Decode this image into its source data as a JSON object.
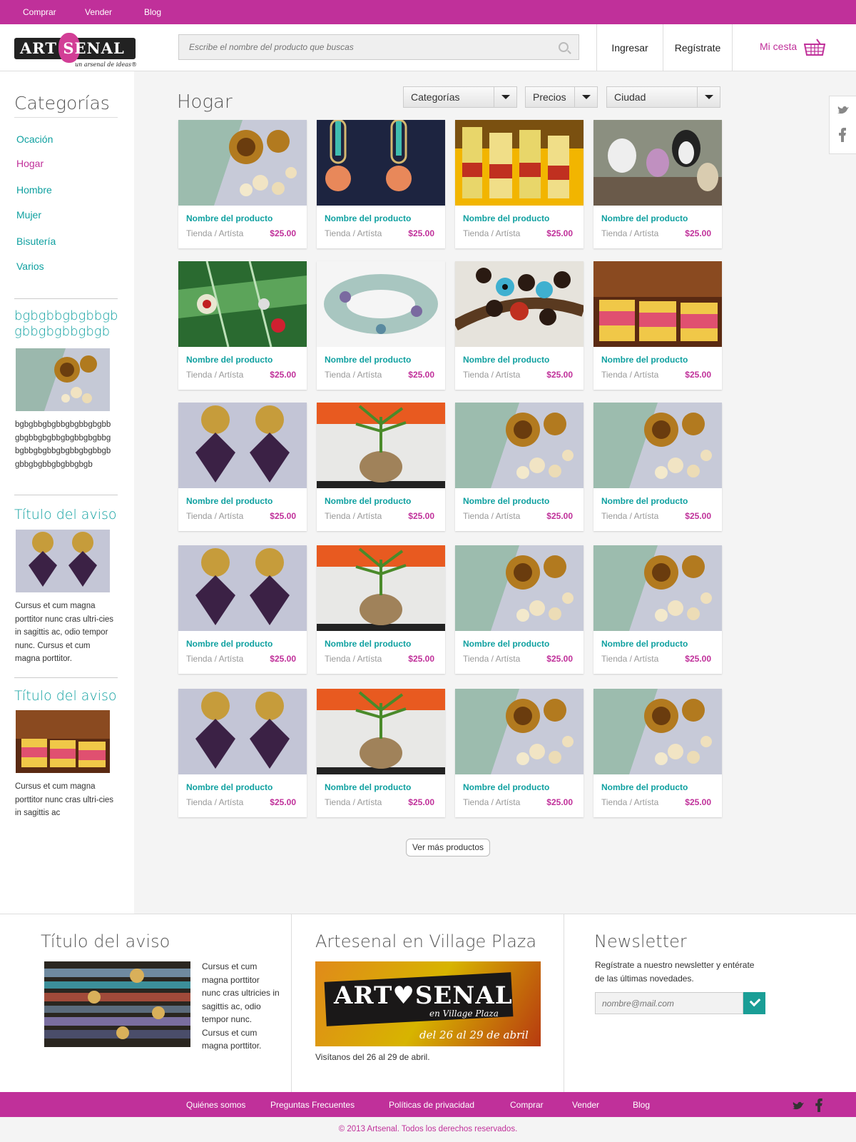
{
  "topnav": {
    "items": [
      "Comprar",
      "Vender",
      "Blog"
    ]
  },
  "header": {
    "logo": {
      "text": "ART SENAL",
      "tagline": "un arsenal de ideas®"
    },
    "search": {
      "placeholder": "Escribe el nombre del producto que buscas",
      "icon": "search-icon"
    },
    "login_label": "Ingresar",
    "register_label": "Regístrate",
    "cart_label": "Mi cesta",
    "cart_icon": "basket-icon"
  },
  "sidebar": {
    "title": "Categorías",
    "categories": [
      "Ocación",
      "Hogar",
      "Hombre",
      "Mujer",
      "Bisutería",
      "Varios"
    ],
    "active_category": "Hogar",
    "promo1": {
      "title": "bgbgbbgbgbbgbgbbgbgbbgbgb",
      "text": "bgbgbbgbgbbgbgbbgbgbbgbgbbgbgbbgbgbbgbgbbgbgbbgbgbbgbgbbgbgbbgbgbbgbgbbgbgbbgbgb"
    },
    "promo2": {
      "title": "Título del aviso",
      "text": "Cursus et cum magna porttitor nunc cras ultri-cies in sagittis ac, odio tempor nunc. Cursus et cum magna porttitor."
    },
    "promo3": {
      "title": "Título del aviso",
      "text": "Cursus et cum magna porttitor nunc cras ultri-cies in sagittis ac"
    }
  },
  "main": {
    "title": "Hogar",
    "filters": [
      "Categorías",
      "Precios",
      "Ciudad"
    ],
    "social": [
      "twitter-icon",
      "facebook-icon"
    ],
    "products": [
      {
        "name": "Nombre del producto",
        "store": "Tienda / Artísta",
        "price": "$25.00",
        "image": "earrings-knot"
      },
      {
        "name": "Nombre del producto",
        "store": "Tienda / Artísta",
        "price": "$25.00",
        "image": "necklace-turquoise"
      },
      {
        "name": "Nombre del producto",
        "store": "Tienda / Artísta",
        "price": "$25.00",
        "image": "bottles"
      },
      {
        "name": "Nombre del producto",
        "store": "Tienda / Artísta",
        "price": "$25.00",
        "image": "penguins"
      },
      {
        "name": "Nombre del producto",
        "store": "Tienda / Artísta",
        "price": "$25.00",
        "image": "brooches"
      },
      {
        "name": "Nombre del producto",
        "store": "Tienda / Artísta",
        "price": "$25.00",
        "image": "bracelet"
      },
      {
        "name": "Nombre del producto",
        "store": "Tienda / Artísta",
        "price": "$25.00",
        "image": "beads"
      },
      {
        "name": "Nombre del producto",
        "store": "Tienda / Artísta",
        "price": "$25.00",
        "image": "jars"
      },
      {
        "name": "Nombre del producto",
        "store": "Tienda / Artísta",
        "price": "$25.00",
        "image": "earrings-flower"
      },
      {
        "name": "Nombre del producto",
        "store": "Tienda / Artísta",
        "price": "$25.00",
        "image": "plant"
      },
      {
        "name": "Nombre del producto",
        "store": "Tienda / Artísta",
        "price": "$25.00",
        "image": "earrings-knot"
      },
      {
        "name": "Nombre del producto",
        "store": "Tienda / Artísta",
        "price": "$25.00",
        "image": "earrings-knot"
      },
      {
        "name": "Nombre del producto",
        "store": "Tienda / Artísta",
        "price": "$25.00",
        "image": "earrings-flower"
      },
      {
        "name": "Nombre del producto",
        "store": "Tienda / Artísta",
        "price": "$25.00",
        "image": "plant"
      },
      {
        "name": "Nombre del producto",
        "store": "Tienda / Artísta",
        "price": "$25.00",
        "image": "earrings-knot"
      },
      {
        "name": "Nombre del producto",
        "store": "Tienda / Artísta",
        "price": "$25.00",
        "image": "earrings-knot"
      },
      {
        "name": "Nombre del producto",
        "store": "Tienda / Artísta",
        "price": "$25.00",
        "image": "earrings-flower"
      },
      {
        "name": "Nombre del producto",
        "store": "Tienda / Artísta",
        "price": "$25.00",
        "image": "plant"
      },
      {
        "name": "Nombre del producto",
        "store": "Tienda / Artísta",
        "price": "$25.00",
        "image": "earrings-knot"
      },
      {
        "name": "Nombre del producto",
        "store": "Tienda / Artísta",
        "price": "$25.00",
        "image": "earrings-knot"
      }
    ],
    "more_label": "Ver más productos"
  },
  "footer_panels": {
    "ad": {
      "title": "Título del aviso",
      "text": "Cursus et cum magna porttitor nunc cras ultricies in sagittis ac, odio tempor nunc. Cursus et cum magna porttitor."
    },
    "event": {
      "title": "Artesenal en Village Plaza",
      "banner_main": "ART♥SENAL",
      "banner_sub": "en Village Plaza",
      "banner_dates": "del 26 al 29 de abril",
      "caption": "Visítanos del 26 al 29 de abril."
    },
    "newsletter": {
      "title": "Newsletter",
      "text": "Regístrate a nuestro newsletter y entérate de las últimas novedades.",
      "placeholder": "nombre@mail.com",
      "submit_icon": "check-icon"
    }
  },
  "bottomnav": {
    "items": [
      "Quiénes somos",
      "Preguntas Frecuentes",
      "Políticas de privacidad",
      "Comprar",
      "Vender",
      "Blog"
    ]
  },
  "copyright": "© 2013 Artsenal. Todos los derechos reservados.",
  "colors": {
    "brand": "#c0309a",
    "accent": "#0fa0a0",
    "button": "#1a9e96"
  }
}
